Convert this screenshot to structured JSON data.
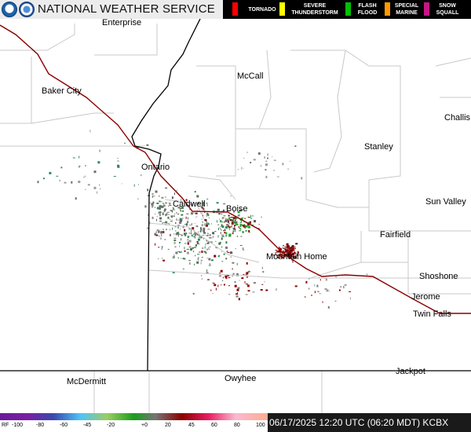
{
  "header": {
    "title": "NATIONAL WEATHER SERVICE",
    "logos": [
      "noaa-logo",
      "nws-logo"
    ]
  },
  "legend": [
    {
      "label": "TORNADO",
      "color": "#ff0000"
    },
    {
      "label": "SEVERE\nTHUNDERSTORM",
      "color": "#ffff00"
    },
    {
      "label": "FLASH\nFLOOD",
      "color": "#00c000"
    },
    {
      "label": "SPECIAL\nMARINE",
      "color": "#ff9900"
    },
    {
      "label": "SNOW\nSQUALL",
      "color": "#c71585"
    }
  ],
  "map": {
    "places": [
      "Enterprise",
      "McCall",
      "Baker City",
      "Challis",
      "Stanley",
      "Ontario",
      "Caldwell",
      "Boise",
      "Sun Valley",
      "Fairfield",
      "Mountain Home",
      "Shoshone",
      "Jerome",
      "Twin Falls",
      "Jackpot",
      "McDermitt",
      "Owyhee"
    ],
    "colors": {
      "background": "#ffffff",
      "county_lines": "#cccccc",
      "state_lines": "#000000",
      "highway": "#8b0000"
    }
  },
  "scale": {
    "prefix": "RF",
    "ticks": [
      "-100",
      "-80",
      "-60",
      "-45",
      "-20",
      "+0",
      "20",
      "45",
      "60",
      "80",
      "100"
    ]
  },
  "timestamp": "06/17/2025 12:20 UTC (06:20 MDT) KCBX"
}
